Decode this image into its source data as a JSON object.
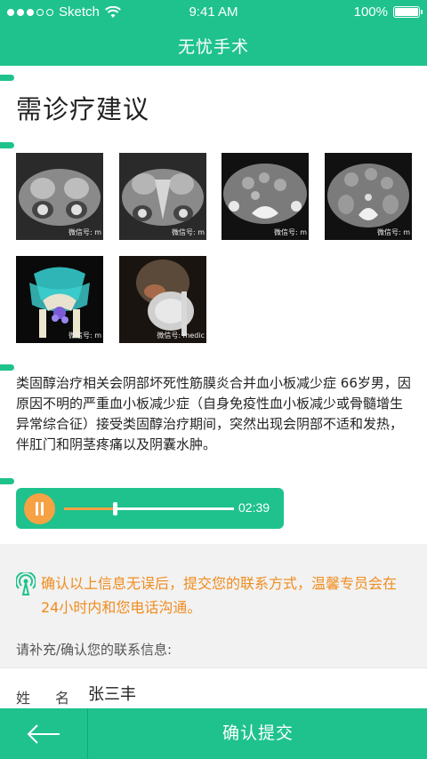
{
  "status_bar": {
    "carrier": "Sketch",
    "time": "9:41 AM",
    "battery": "100%"
  },
  "nav": {
    "title": "无忧手术"
  },
  "card": {
    "heading": "需诊疗建议",
    "images": [
      {
        "icon": "ct-scan-image",
        "watermark": "微信号: m"
      },
      {
        "icon": "ct-scan-image",
        "watermark": "微信号: m"
      },
      {
        "icon": "ct-scan-image",
        "watermark": "微信号: m"
      },
      {
        "icon": "ct-scan-image",
        "watermark": "微信号: m"
      },
      {
        "icon": "3d-reconstruction-image",
        "watermark": "微信号: m"
      },
      {
        "icon": "3d-reconstruction-image",
        "watermark": "微信号: medic"
      }
    ],
    "description": "类固醇治疗相关会阴部坏死性筋膜炎合并血小板减少症   66岁男，因原因不明的严重血小板减少症（自身免疫性血小板减少或骨髓增生异常综合征）接受类固醇治疗期间，突然出现会阴部不适和发热，伴肛门和阴茎疼痛以及阴囊水肿。",
    "audio": {
      "duration": "02:39",
      "progress": 0.3
    }
  },
  "notice": {
    "text": "确认以上信息无误后，提交您的联系方式，温馨专员会在24小时内和您电话沟通。",
    "hint": "请补充/确认您的联系信息:"
  },
  "form": {
    "name_label": "姓名",
    "name_value": "张三丰"
  },
  "bottom_bar": {
    "submit_label": "确认提交"
  },
  "colors": {
    "primary": "#1fc28d",
    "accent": "#f6a244",
    "notice_text": "#f08c1e"
  }
}
